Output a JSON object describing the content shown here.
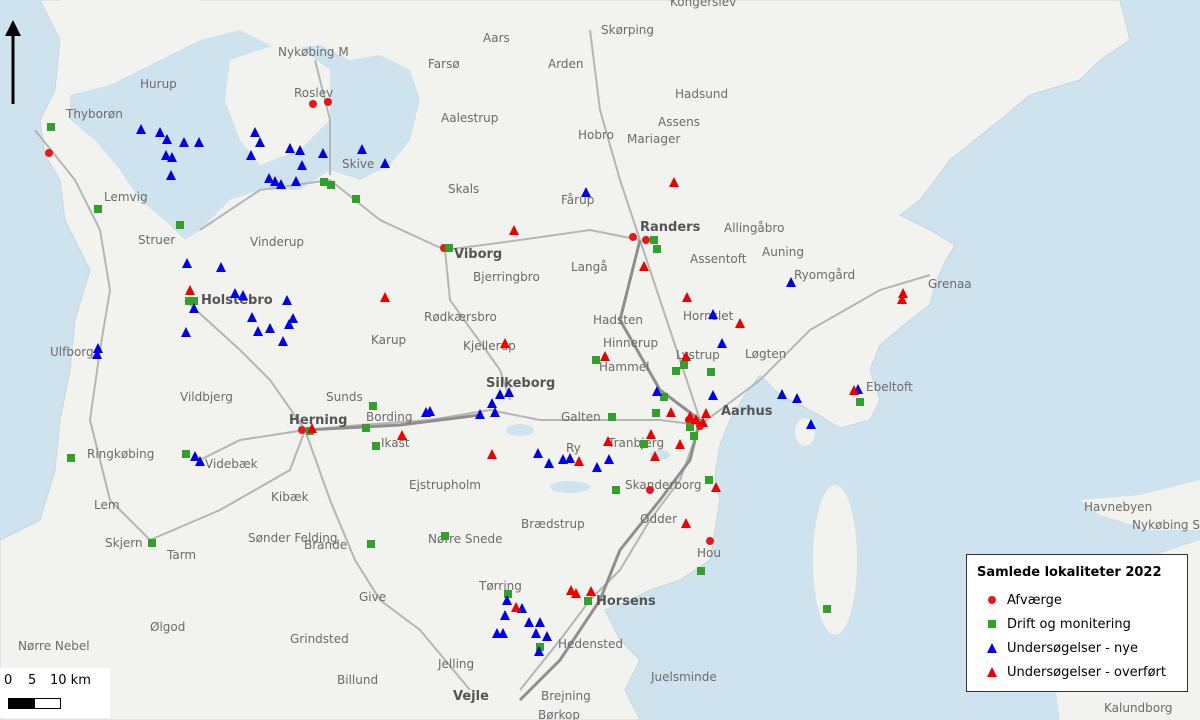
{
  "colors": {
    "water": "#cfe3ef",
    "land": "#f2f2ee",
    "road": "#b8b8b8",
    "motorway": "#9a9a9a",
    "afvaerge": "#e31a1c",
    "drift": "#33a02c",
    "nye": "#0000e6",
    "overfort": "#ee0000"
  },
  "legend": {
    "title": "Samlede lokaliteter 2022",
    "items": [
      {
        "label": "Afværge",
        "symbol": "circle",
        "color": "#e31a1c"
      },
      {
        "label": "Drift og monitering",
        "symbol": "square",
        "color": "#33a02c"
      },
      {
        "label": "Undersøgelser - nye",
        "symbol": "triangle",
        "color": "#0000e6"
      },
      {
        "label": "Undersøgelser - overført",
        "symbol": "triangle",
        "color": "#ee0000"
      }
    ]
  },
  "scale_bar": {
    "labels": [
      "0",
      "5",
      "10 km"
    ]
  },
  "north_arrow": "north-arrow-icon",
  "places": [
    "Nykøbing M",
    "Aars",
    "Farsø",
    "Arden",
    "Skørping",
    "Hadsund",
    "Hurup",
    "Thyborøn",
    "Roslev",
    "Aalestrup",
    "Hobro",
    "Mariager",
    "Assens",
    "Skive",
    "Skals",
    "Fårup",
    "Lemvig",
    "Struer",
    "Vinderup",
    "Viborg",
    "Randers",
    "Allingåbro",
    "Auning",
    "Assentoft",
    "Ryomgård",
    "Grenaa",
    "Bjerringbro",
    "Langå",
    "Holstebro",
    "Rødkærsbro",
    "Hadsten",
    "Hornslet",
    "Karup",
    "Kjellerup",
    "Hinnerup",
    "Lystrup",
    "Løgten",
    "Ulfborg",
    "Silkeborg",
    "Hammel",
    "Ebeltoft",
    "Sunds",
    "Vildbjerg",
    "Herning",
    "Bording",
    "Galten",
    "Aarhus",
    "Ringkøbing",
    "Ikast",
    "Ry",
    "Tranbjerg",
    "Videbæk",
    "Skanderborg",
    "Kibæk",
    "Ejstrupholm",
    "Havnebyen",
    "Lem",
    "Odder",
    "Nykøbing Sj",
    "Skjern",
    "Tarm",
    "Sønder Felding",
    "Brande",
    "Nørre Snede",
    "Brædstrup",
    "Hou",
    "Tørring",
    "Horsens",
    "Give",
    "Ølgod",
    "Grindsted",
    "Hedensted",
    "Nørre Nebel",
    "Jelling",
    "Billund",
    "Juelsminde",
    "Vejle",
    "Brejning",
    "Børkop",
    "Kongerslev",
    "Kalundborg"
  ]
}
